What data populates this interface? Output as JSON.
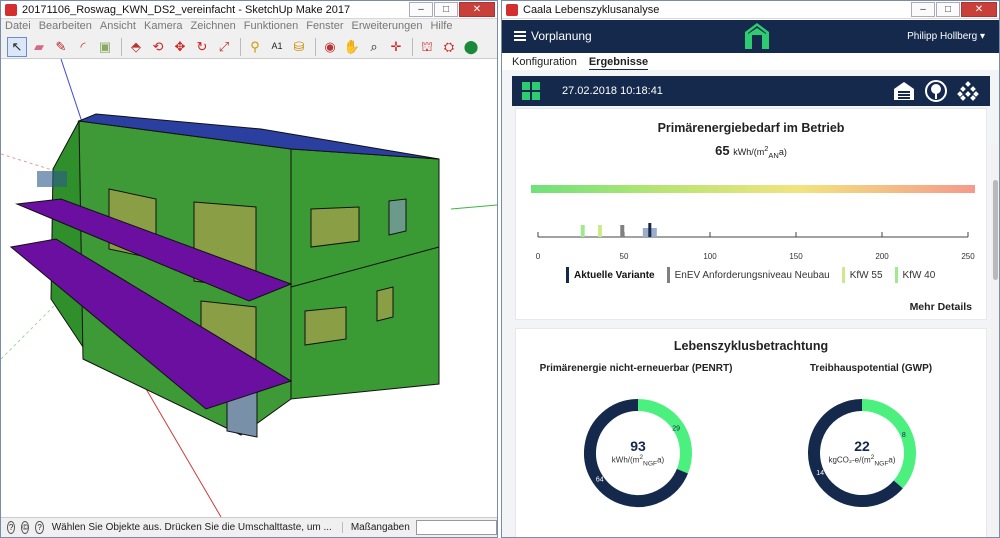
{
  "left_window": {
    "title": "20171106_Roswag_KWN_DS2_vereinfacht - SketchUp Make 2017",
    "menu": [
      "Datei",
      "Bearbeiten",
      "Ansicht",
      "Kamera",
      "Zeichnen",
      "Funktionen",
      "Fenster",
      "Erweiterungen",
      "Hilfe"
    ],
    "toolbar_icons": [
      "select-icon",
      "eraser-icon",
      "pencil-icon",
      "arc-icon",
      "rectangle-icon",
      "push-pull-icon",
      "follow-me-icon",
      "move-icon",
      "rotate-icon",
      "scale-icon",
      "tape-measure-icon",
      "text-icon",
      "paint-bucket-icon",
      "orbit-icon",
      "pan-icon",
      "zoom-icon",
      "zoom-extents-icon",
      "warehouse-icon",
      "extension-warehouse-icon",
      "sketchup-icon"
    ],
    "status_message": "Wählen Sie Objekte aus. Drücken Sie die Umschalttaste, um ...",
    "measurements_label": "Maßangaben"
  },
  "right_window": {
    "title": "Caala Lebenszyklusanalyse",
    "nav_menu": "Vorplanung",
    "user": "Philipp Hollberg",
    "tabs": [
      "Konfiguration",
      "Ergebnisse"
    ],
    "active_tab": "Ergebnisse",
    "result_date": "27.02.2018 10:18:41",
    "result_icons": [
      "building-report-icon",
      "tree-icon",
      "grid-dots-icon"
    ],
    "pe_card": {
      "title": "Primärenergiebedarf im Betrieb",
      "value": "65",
      "unit_prefix": "kWh/(m",
      "unit_sup": "2",
      "unit_sub": "AN",
      "unit_suffix": "a)",
      "more_details": "Mehr Details"
    },
    "lca_card": {
      "title": "Lebenszyklusbetrachtung",
      "penrt_title": "Primärenergie nicht-erneuerbar (PENRT)",
      "gwp_title": "Treibhauspotential (GWP)",
      "penrt_value": "93",
      "penrt_unit_prefix": "kWh/(m",
      "penrt_unit_sup": "2",
      "penrt_unit_sub": "NGF",
      "penrt_unit_suffix": "a)",
      "gwp_value": "22",
      "gwp_unit_prefix": "kgCO₂-e/(m",
      "gwp_unit_sup": "2",
      "gwp_unit_sub": "NGF",
      "gwp_unit_suffix": "a)"
    },
    "colors": {
      "navy": "#14294b",
      "green": "#2ecc71",
      "donut_green": "#4cf07f",
      "grey_marker": "#808080",
      "kfw55": "#cdea8a",
      "kfw40": "#9fe98e"
    }
  },
  "chart_data": [
    {
      "type": "bar",
      "title": "Primärenergiebedarf im Betrieb",
      "xlim": [
        0,
        250
      ],
      "xticks": [
        0,
        50,
        100,
        150,
        200,
        250
      ],
      "series": [
        {
          "name": "Aktuelle Variante",
          "value": 65
        },
        {
          "name": "EnEV Anforderungsniveau Neubau",
          "value": 49
        },
        {
          "name": "KfW 55",
          "value": 36
        },
        {
          "name": "KfW 40",
          "value": 26
        }
      ]
    },
    {
      "type": "pie",
      "title": "Primärenergie nicht-erneuerbar (PENRT)",
      "total": 93,
      "slices": [
        {
          "value": 64,
          "color": "#14294b"
        },
        {
          "value": 29,
          "color": "#4cf07f"
        }
      ]
    },
    {
      "type": "pie",
      "title": "Treibhauspotential (GWP)",
      "total": 22,
      "slices": [
        {
          "value": 14,
          "color": "#14294b"
        },
        {
          "value": 8,
          "color": "#4cf07f"
        }
      ]
    }
  ]
}
